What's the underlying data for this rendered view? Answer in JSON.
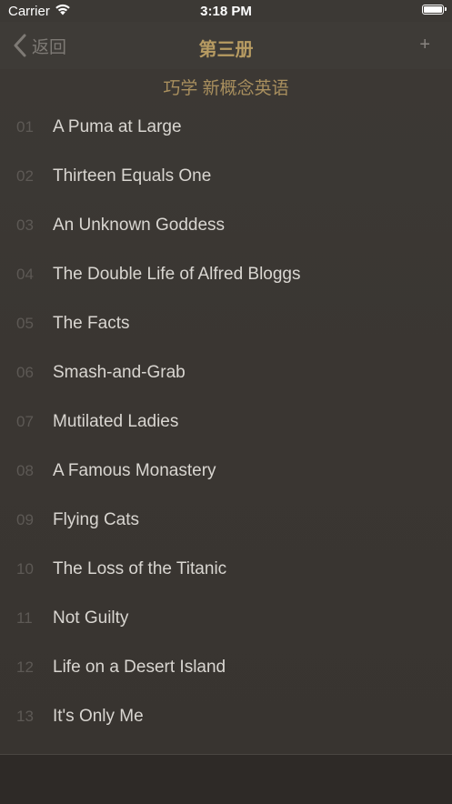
{
  "status_bar": {
    "carrier": "Carrier",
    "time": "3:18 PM"
  },
  "nav": {
    "back_label": "返回",
    "title": "第三册",
    "add_label": "+"
  },
  "subtitle": "巧学 新概念英语",
  "lessons": [
    {
      "num": "01",
      "title": "A Puma at Large"
    },
    {
      "num": "02",
      "title": "Thirteen Equals One"
    },
    {
      "num": "03",
      "title": "An Unknown Goddess"
    },
    {
      "num": "04",
      "title": "The Double Life of Alfred Bloggs"
    },
    {
      "num": "05",
      "title": "The Facts"
    },
    {
      "num": "06",
      "title": "Smash-and-Grab"
    },
    {
      "num": "07",
      "title": "Mutilated Ladies"
    },
    {
      "num": "08",
      "title": "A Famous Monastery"
    },
    {
      "num": "09",
      "title": "Flying Cats"
    },
    {
      "num": "10",
      "title": "The Loss of the Titanic"
    },
    {
      "num": "11",
      "title": "Not Guilty"
    },
    {
      "num": "12",
      "title": "Life on a Desert Island"
    },
    {
      "num": "13",
      "title": "It's Only Me"
    }
  ],
  "colors": {
    "background": "#3a3733",
    "accent_gold": "#b79b62",
    "number_gray": "#5d5955",
    "title_text": "#d9d6d1"
  }
}
